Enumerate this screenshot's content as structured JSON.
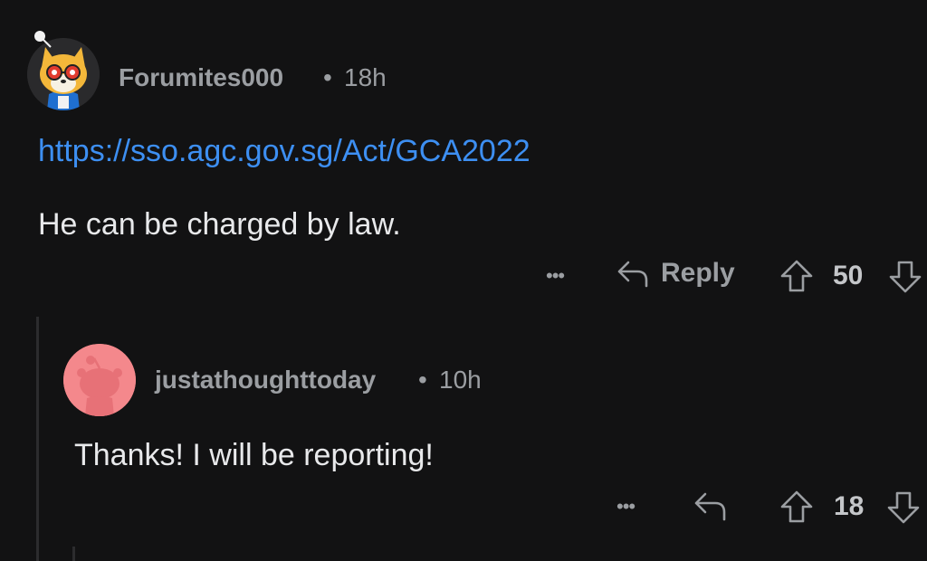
{
  "comments": [
    {
      "username": "Forumites000",
      "separator": "•",
      "time": "18h",
      "link": "https://sso.agc.gov.sg/Act/GCA2022",
      "text": "He can be charged by law.",
      "more_label": "•••",
      "reply_label": "Reply",
      "score": "50",
      "avatar_icon": "shiba-avatar-icon"
    },
    {
      "username": "justathoughttoday",
      "separator": "•",
      "time": "10h",
      "text": "Thanks! I will be reporting!",
      "more_label": "•••",
      "score": "18",
      "avatar_icon": "snoo-avatar-icon"
    }
  ],
  "colors": {
    "background": "#121213",
    "link": "#3d8ff2",
    "muted": "#9b9ea2",
    "text": "#e8e9eb",
    "avatar_pink": "#f4888c"
  }
}
